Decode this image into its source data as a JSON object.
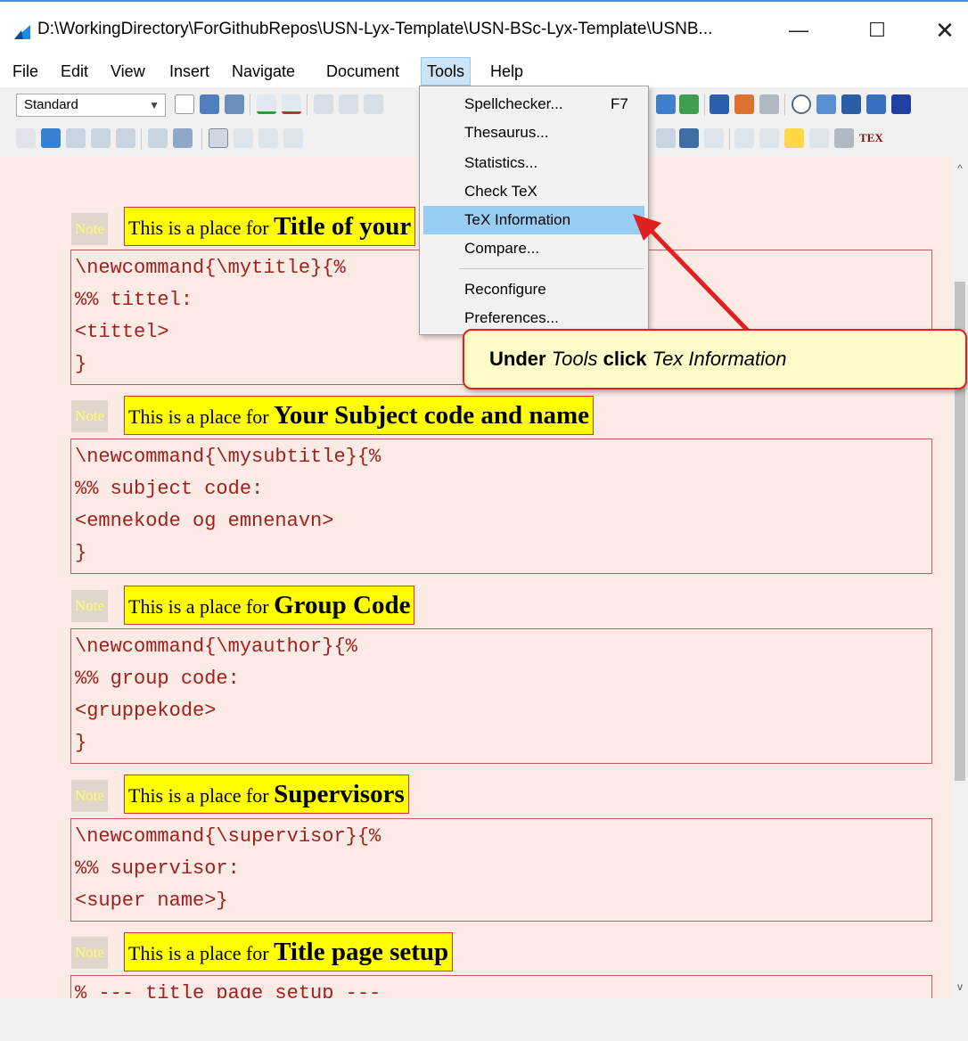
{
  "window": {
    "title": "D:\\WorkingDirectory\\ForGithubRepos\\USN-Lyx-Template\\USN-BSc-Lyx-Template\\USNB...",
    "minimize": "—",
    "maximize": "☐",
    "close": "✕"
  },
  "menubar": {
    "items": [
      "File",
      "Edit",
      "View",
      "Insert",
      "Navigate",
      "Document",
      "Tools",
      "Help"
    ]
  },
  "toolbar": {
    "style_value": "Standard"
  },
  "tools_menu": {
    "items": [
      {
        "label": "Spellchecker...",
        "shortcut": "F7"
      },
      {
        "label": "Thesaurus..."
      },
      {
        "label": "Statistics..."
      },
      {
        "label": "Check TeX"
      },
      {
        "label": "TeX Information"
      },
      {
        "label": "Compare..."
      },
      {
        "label": "Reconfigure"
      },
      {
        "label": "Preferences..."
      }
    ]
  },
  "callout": {
    "bold1": "Under",
    "italic1": "Tools",
    "bold2": "click",
    "italic2": "Tex Information"
  },
  "document": {
    "sections": [
      {
        "note": "Note",
        "prefix": "This is a place for ",
        "title": "Title of your",
        "code": "\\newcommand{\\mytitle}{%\n%% tittel:\n<tittel>\n}"
      },
      {
        "note": "Note",
        "prefix": "This is a place for ",
        "title": "Your Subject code and name",
        "code": "\\newcommand{\\mysubtitle}{%\n%% subject code:\n<emnekode og emnenavn>\n}"
      },
      {
        "note": "Note",
        "prefix": "This is a place for ",
        "title": "Group Code",
        "code": "\\newcommand{\\myauthor}{%\n%% group code:\n<gruppekode>\n}"
      },
      {
        "note": "Note",
        "prefix": "This is a place for ",
        "title": "Supervisors",
        "code": "\\newcommand{\\supervisor}{%\n%% supervisor:\n<super name>}"
      },
      {
        "note": "Note",
        "prefix": "This is a place for ",
        "title": "Title page setup",
        "code": "% --- title page setup ---"
      }
    ]
  },
  "colors": {
    "doc_bg": "#fcebe5",
    "heading_bg": "#ffff00",
    "code_text": "#a02020",
    "highlight": "#99ccf3",
    "callout_border": "#e02020"
  }
}
